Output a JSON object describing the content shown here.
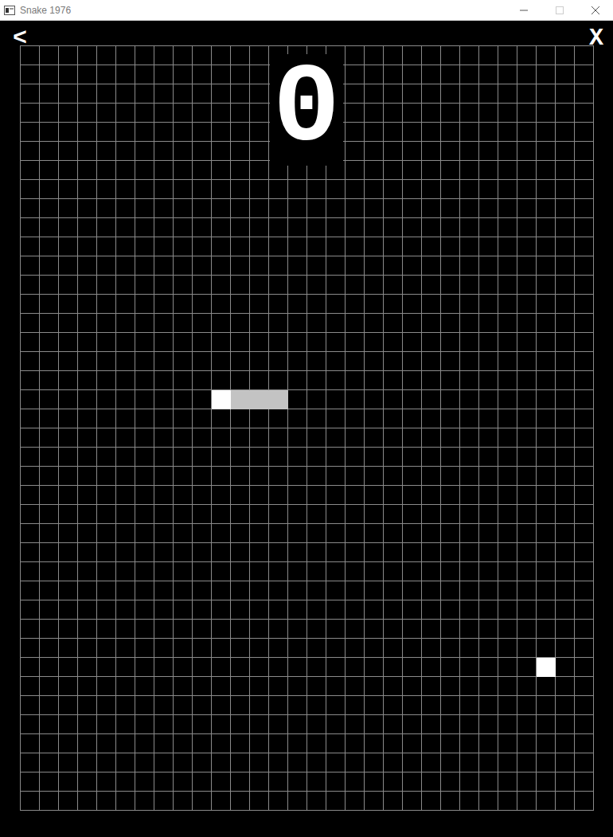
{
  "window": {
    "title": "Snake 1976"
  },
  "back": "<",
  "close": "X",
  "score": "0",
  "board": {
    "cols": 30,
    "rows": 40
  },
  "snake": [
    {
      "kind": "head",
      "col": 10,
      "row": 18
    },
    {
      "kind": "body",
      "col": 11,
      "row": 18
    },
    {
      "kind": "body",
      "col": 12,
      "row": 18
    },
    {
      "kind": "body",
      "col": 13,
      "row": 18
    }
  ],
  "food": {
    "col": 27,
    "row": 32
  }
}
